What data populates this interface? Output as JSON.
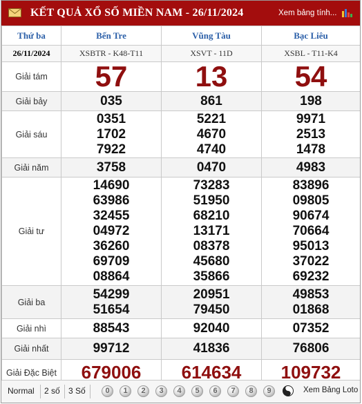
{
  "header": {
    "title": "KẾT QUẢ XỔ SỐ MIỀN NAM - 26/11/2024",
    "view_link": "Xem bảng tính...",
    "mail_icon": "mail-icon",
    "chart_icon": "bar-chart-icon"
  },
  "table": {
    "weekday": "Thứ ba",
    "date": "26/11/2024",
    "provinces": [
      "Bến Tre",
      "Vũng Tàu",
      "Bạc Liêu"
    ],
    "codes": [
      "XSBTR - K48-T11",
      "XSVT - 11D",
      "XSBL - T11-K4"
    ],
    "prizes": [
      {
        "label": "Giải tám",
        "values": [
          [
            "57"
          ],
          [
            "13"
          ],
          [
            "54"
          ]
        ]
      },
      {
        "label": "Giải bảy",
        "values": [
          [
            "035"
          ],
          [
            "861"
          ],
          [
            "198"
          ]
        ]
      },
      {
        "label": "Giải sáu",
        "values": [
          [
            "0351",
            "1702",
            "7922"
          ],
          [
            "5221",
            "4670",
            "4740"
          ],
          [
            "9971",
            "2513",
            "1478"
          ]
        ]
      },
      {
        "label": "Giải năm",
        "values": [
          [
            "3758"
          ],
          [
            "0470"
          ],
          [
            "4983"
          ]
        ]
      },
      {
        "label": "Giải tư",
        "values": [
          [
            "14690",
            "63986",
            "32455",
            "04972",
            "36260",
            "69709",
            "08864"
          ],
          [
            "73283",
            "51950",
            "68210",
            "13171",
            "08378",
            "45680",
            "35866"
          ],
          [
            "83896",
            "09805",
            "90674",
            "70664",
            "95013",
            "37022",
            "69232"
          ]
        ]
      },
      {
        "label": "Giải ba",
        "values": [
          [
            "54299",
            "51654"
          ],
          [
            "20951",
            "79450"
          ],
          [
            "49853",
            "01868"
          ]
        ]
      },
      {
        "label": "Giải nhì",
        "values": [
          [
            "88543"
          ],
          [
            "92040"
          ],
          [
            "07352"
          ]
        ]
      },
      {
        "label": "Giải nhất",
        "values": [
          [
            "99712"
          ],
          [
            "41836"
          ],
          [
            "76806"
          ]
        ]
      },
      {
        "label": "Giải Đặc Biệt",
        "values": [
          [
            "679006"
          ],
          [
            "614634"
          ],
          [
            "109732"
          ]
        ]
      }
    ]
  },
  "footer": {
    "tabs": [
      "Normal",
      "2 số",
      "3 Số"
    ],
    "digits": [
      "0",
      "1",
      "2",
      "3",
      "4",
      "5",
      "6",
      "7",
      "8",
      "9"
    ],
    "loto_link": "Xem Bảng Loto",
    "yin_icon": "yin-yang-icon"
  },
  "colors": {
    "title_bg": "#a30d0d",
    "province_text": "#2b5fa8",
    "highlight_number": "#8f0f0f"
  }
}
